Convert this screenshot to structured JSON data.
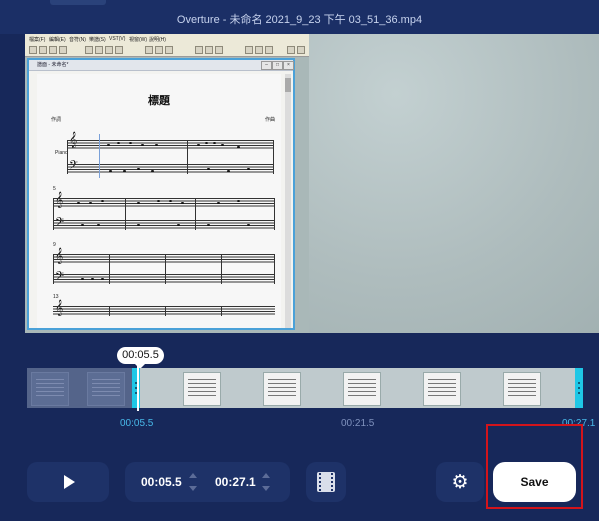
{
  "window": {
    "title": "Overture - 未命名 2021_9_23 下午 03_51_36.mp4"
  },
  "score": {
    "menu": [
      "檔案(F)",
      "編輯(E)",
      "音符(N)",
      "樂譜(S)",
      "VST(V)",
      "視窗(W)",
      "說明(H)"
    ],
    "doc_title": "譜面 - 未命名*",
    "title": "標題",
    "lyricist": "作詞",
    "composer": "作曲",
    "instrument": "Piano",
    "measure_numbers": [
      "5",
      "9",
      "13"
    ]
  },
  "timeline": {
    "current_time": "00:05.5",
    "labels": {
      "start": "00:05.5",
      "mid": "00:21.5",
      "end": "00:27.1"
    }
  },
  "controls": {
    "start_time": "00:05.5",
    "end_time": "00:27.1",
    "save_label": "Save"
  },
  "colors": {
    "background": "#17285a",
    "accent": "#1fc7e6",
    "highlight": "#d3141b"
  },
  "icons": {
    "play": "play-icon",
    "split": "film-icon",
    "settings": "gear-icon"
  }
}
